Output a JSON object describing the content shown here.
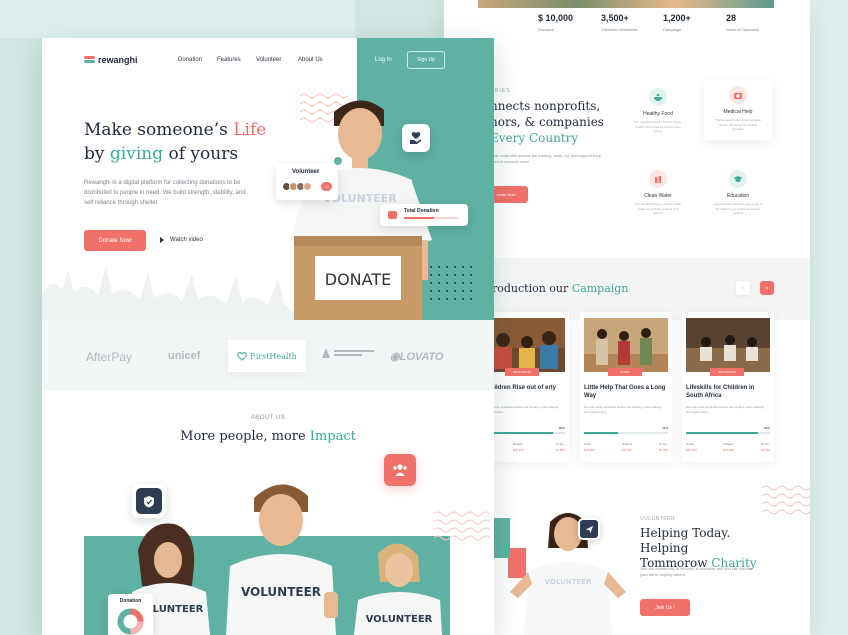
{
  "colors": {
    "teal": "#5fb1a3",
    "coral": "#f0706a",
    "navy": "#1e2b3c"
  },
  "brand": {
    "name": "rewanghi"
  },
  "nav": {
    "links": [
      "Donation",
      "Features",
      "Volunteer",
      "About Us"
    ],
    "login": "Log In",
    "signup": "Sign Up"
  },
  "hero": {
    "title_line1_pre": "Make someone’s ",
    "title_line1_accent": "Life",
    "title_line2_pre": "by ",
    "title_line2_accent": "giving",
    "title_line2_post": " of yours",
    "description": "Rewanghi is a digital platform for collecting donations to be distributed to people in need. We build strength, stability, and self reliance through shelter.",
    "donate_button": "Donate Now",
    "watch_video": "Watch video",
    "box_label": "DONATE",
    "volunteer_card": {
      "title": "Volunteer",
      "count": "+12"
    },
    "donation_card": {
      "title": "Total Donation",
      "progress": 0.55
    }
  },
  "partners": [
    "AfterPay",
    "unicef",
    "FirstHealth",
    "",
    "LOVATO"
  ],
  "about": {
    "subtitle": "ABOUT US",
    "title_pre": "More people, more ",
    "title_accent": "Impact",
    "donut_label": "Donation"
  },
  "stats": [
    {
      "value": "$ 10,000",
      "label": "Donation"
    },
    {
      "value": "3,500+",
      "label": "Volunteer Worldwide"
    },
    {
      "value": "1,200+",
      "label": "Campaign"
    },
    {
      "value": "28",
      "label": "Years of Operation"
    }
  ],
  "categories": {
    "subtitle": "ORIES",
    "title_line1": "nnects nonprofits,",
    "title_line2": "nors, & companies",
    "title_line3_accent": "Every Country",
    "description": "local nonprofits access the funding, tools, ng, and support they need to become more",
    "button": "onate Now",
    "items": [
      {
        "name": "Healthy Food",
        "text": "The standard chunk of lorem ipsum, healthy food used for cooking and giving"
      },
      {
        "name": "Medical Help",
        "text": "The standard lorem ipsum medical service offered by the welfare donation"
      },
      {
        "name": "Clean Water",
        "text": "The standard chunk of lorem clean water for drinking cooking and bathing"
      },
      {
        "name": "Education",
        "text": "Give the best education and a free to all children everywhere across the network"
      }
    ]
  },
  "campaign": {
    "title_pre": "roduction our ",
    "title_accent": "Campaign",
    "cards": [
      {
        "tag": "EDUCATION",
        "name": "p Children Rise out of erty",
        "desc": "We help local nonprofits access the funding, tools, training, and support they",
        "pct": "86%",
        "progress": 0.86,
        "goal_label": "",
        "goal": "",
        "raised_label": "Raised",
        "raised": "$15,600",
        "togo_label": "To Go",
        "togo": "$4,800"
      },
      {
        "tag": "FOOD",
        "name": "Little Help That Goes a Long Way",
        "desc": "We help local nonprofits access the funding, tools, training, and support they",
        "pct": "41%",
        "progress": 0.41,
        "goal_label": "Goal",
        "goal": "$15,000",
        "raised_label": "Raised",
        "raised": "$8,700",
        "togo_label": "To Go",
        "togo": "$7,300"
      },
      {
        "tag": "EDUCATION",
        "name": "Lifeskills for Children in South Africa",
        "desc": "We help local nonprofits access the funding, tools, training, and support they",
        "pct": "86%",
        "progress": 0.86,
        "goal_label": "Goals",
        "goal": "$22,000",
        "raised_label": "Raised",
        "raised": "$20,250",
        "togo_label": "To Go",
        "togo": "$1,230"
      }
    ]
  },
  "volunteer": {
    "subtitle": "VOLUNTEER",
    "title_line1": "Helping Today. Helping",
    "title_line2_pre": "Tommorow ",
    "title_line2_accent": "Charity",
    "description": "Join our community to become a volunteer and you can elevate your life to helping others.",
    "button": "Join Us !",
    "shirt_text": "VOLUNTEER"
  },
  "team_shirt_text": "VOLUNTEER"
}
